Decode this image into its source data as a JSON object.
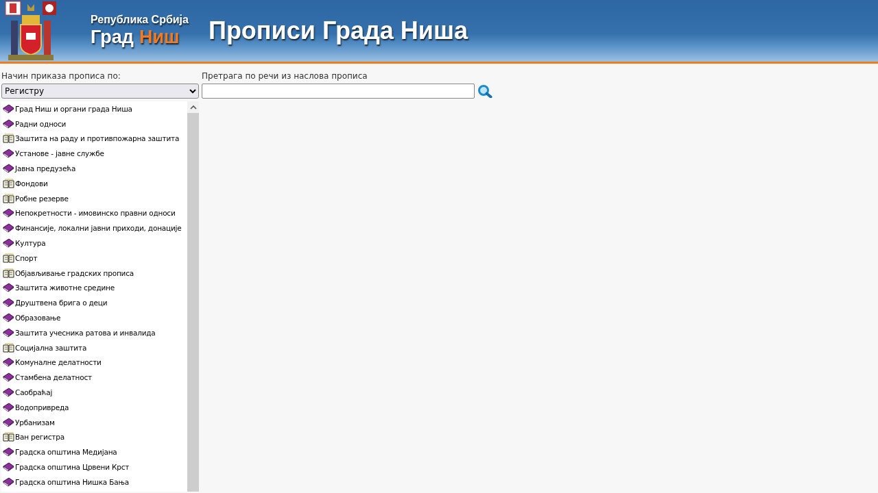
{
  "header": {
    "country": "Република Србија",
    "city_label": "Град",
    "city_name": "Ниш",
    "title": "Прописи Града Ниша"
  },
  "view_mode": {
    "label": "Начин приказа прописа по:",
    "value": "Регистру"
  },
  "search": {
    "label": "Претрага по речи из наслова прописа"
  },
  "tree": {
    "items": [
      {
        "label": "Град Ниш и органи града Ниша",
        "kind": "closed"
      },
      {
        "label": "Радни односи",
        "kind": "closed"
      },
      {
        "label": "Заштита на раду и противпожарна заштита",
        "kind": "open"
      },
      {
        "label": "Установе - јавне службе",
        "kind": "closed"
      },
      {
        "label": "Јавна предузећа",
        "kind": "closed"
      },
      {
        "label": "Фондови",
        "kind": "open"
      },
      {
        "label": "Робне резерве",
        "kind": "open"
      },
      {
        "label": "Непокретности - имовинско правни односи",
        "kind": "closed"
      },
      {
        "label": "Финансије, локални јавни приходи, донације",
        "kind": "closed"
      },
      {
        "label": "Култура",
        "kind": "closed"
      },
      {
        "label": "Спорт",
        "kind": "open"
      },
      {
        "label": "Објављивање градских прописа",
        "kind": "open"
      },
      {
        "label": "Заштита животне средине",
        "kind": "closed"
      },
      {
        "label": "Друштвена брига о деци",
        "kind": "closed"
      },
      {
        "label": "Образовање",
        "kind": "closed"
      },
      {
        "label": "Заштита учесника ратова и инвалида",
        "kind": "closed"
      },
      {
        "label": "Социјална заштита",
        "kind": "open"
      },
      {
        "label": "Комуналне делатности",
        "kind": "closed"
      },
      {
        "label": "Стамбена делатност",
        "kind": "closed"
      },
      {
        "label": "Саобраћај",
        "kind": "closed"
      },
      {
        "label": "Водопривреда",
        "kind": "closed"
      },
      {
        "label": "Урбанизам",
        "kind": "closed"
      },
      {
        "label": "Ван регистра",
        "kind": "open"
      },
      {
        "label": "Градска општина Медијана",
        "kind": "closed"
      },
      {
        "label": "Градска општина Црвени Крст",
        "kind": "closed"
      },
      {
        "label": "Градска општина Нишка Бања",
        "kind": "closed"
      }
    ]
  }
}
